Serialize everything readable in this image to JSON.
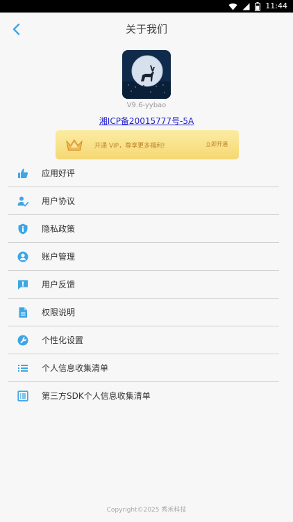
{
  "status_bar": {
    "time": "11:44"
  },
  "header": {
    "title": "关于我们"
  },
  "app": {
    "version": "V9.6-yybao",
    "icp": "湘ICP备20015777号-5A"
  },
  "vip_banner": {
    "text": "开通 VIP，尊享更多福利!",
    "action": "立即开通"
  },
  "menu": {
    "items": [
      {
        "label": "应用好评",
        "icon": "thumbs-up-icon"
      },
      {
        "label": "用户协议",
        "icon": "user-agreement-icon"
      },
      {
        "label": "隐私政策",
        "icon": "privacy-shield-icon"
      },
      {
        "label": "账户管理",
        "icon": "account-icon"
      },
      {
        "label": "用户反馈",
        "icon": "feedback-icon"
      },
      {
        "label": "权限说明",
        "icon": "document-icon"
      },
      {
        "label": "个性化设置",
        "icon": "wrench-icon"
      },
      {
        "label": "个人信息收集清单",
        "icon": "list-icon"
      },
      {
        "label": "第三方SDK个人信息收集清单",
        "icon": "sdk-list-icon"
      }
    ]
  },
  "footer": {
    "copyright": "Copyright©2025 秀禾科技"
  },
  "colors": {
    "accent": "#3ea6e6",
    "vip_gold": "#c0822b",
    "icp_link": "#2222cc"
  }
}
